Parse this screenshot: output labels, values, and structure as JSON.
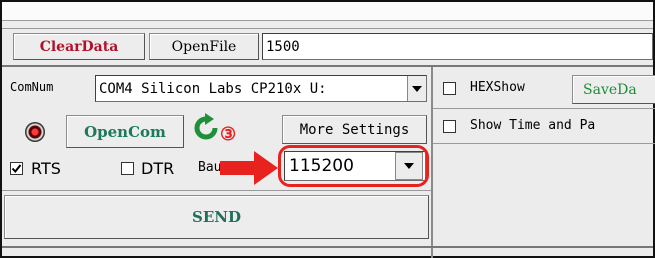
{
  "toolbar": {
    "clear_label": "ClearData",
    "openfile_label": "OpenFile",
    "path_value": "1500"
  },
  "port": {
    "comnum_label": "ComNum",
    "selected": "COM4 Silicon Labs CP210x U:",
    "opencom_label": "OpenCom",
    "more_settings_label": "More Settings",
    "rts_label": "RTS",
    "dtr_label": "DTR",
    "baud_label": "BaudRat",
    "baud_value": "115200",
    "rts_checked": true,
    "dtr_checked": false
  },
  "right": {
    "hexshow_label": "HEXShow",
    "savedata_label": "SaveDa",
    "showtime_label": "Show Time and Pa"
  },
  "send": {
    "label": "SEND"
  },
  "annotation": {
    "step": "③",
    "color": "#e8231f"
  },
  "colors": {
    "clear": "#b3102a",
    "opencom": "#1a7a5a",
    "savedata": "#1f8a3a",
    "send": "#1f6f5a",
    "refresh": "#1f8f3a"
  }
}
